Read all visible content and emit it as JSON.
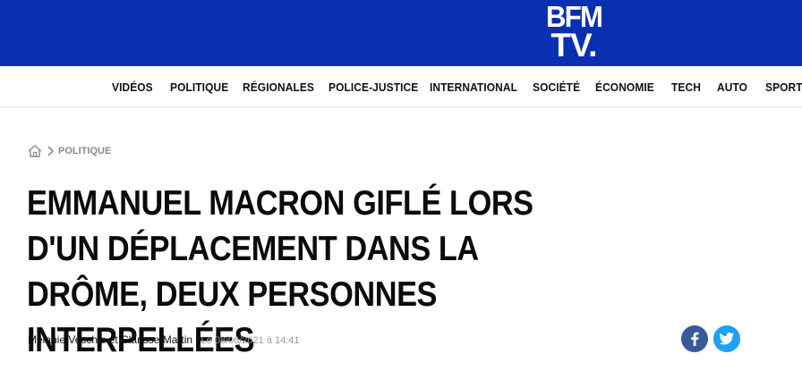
{
  "header": {
    "logo_line1": "BFM",
    "logo_line2": "TV.",
    "colors": {
      "brand": "#0a2fb0"
    }
  },
  "nav": {
    "items": [
      {
        "label": "VIDÉOS"
      },
      {
        "label": "POLITIQUE"
      },
      {
        "label": "RÉGIONALES"
      },
      {
        "label": "POLICE-JUSTICE"
      },
      {
        "label": "INTERNATIONAL"
      },
      {
        "label": "SOCIÉTÉ"
      },
      {
        "label": "ÉCONOMIE"
      },
      {
        "label": "TECH"
      },
      {
        "label": "AUTO"
      },
      {
        "label": "SPORT"
      }
    ]
  },
  "breadcrumb": {
    "home_icon": "home-icon",
    "separator_icon": "chevron-right-icon",
    "section": "POLITIQUE"
  },
  "article": {
    "title": "EMMANUEL MACRON GIFLÉ LORS D'UN DÉPLACEMENT DANS LA DRÔME, DEUX PERSONNES INTERPELLÉES",
    "authors": "Mélanie Vecchio et Clarisse Martin",
    "date": "Le 08/06/2021 à 14:41"
  },
  "share": {
    "facebook_icon": "facebook-icon",
    "twitter_icon": "twitter-icon",
    "colors": {
      "facebook": "#3b5998",
      "twitter": "#1da1f2"
    }
  }
}
